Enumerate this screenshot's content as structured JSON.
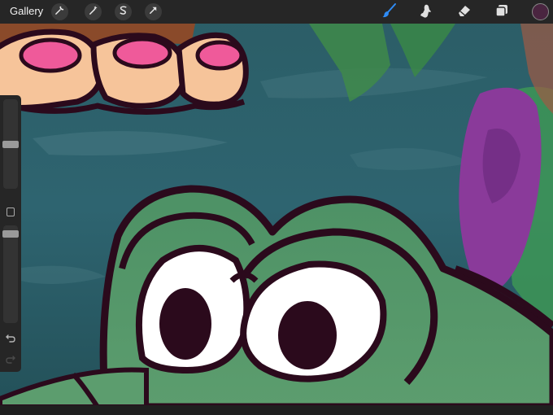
{
  "toolbar": {
    "gallery_label": "Gallery",
    "left_tools": [
      "wrench-icon",
      "magic-wand-icon",
      "selection-icon",
      "transform-icon"
    ],
    "right_tools": [
      "brush-icon",
      "smudge-icon",
      "eraser-icon",
      "layers-icon"
    ],
    "active_tool": "brush-icon",
    "active_color": "#4a2540",
    "accent_color": "#2f8cf6"
  },
  "sidebar": {
    "brush_size": 0.5,
    "brush_opacity": 0.95,
    "buttons": [
      "modify-square",
      "undo",
      "redo"
    ]
  }
}
